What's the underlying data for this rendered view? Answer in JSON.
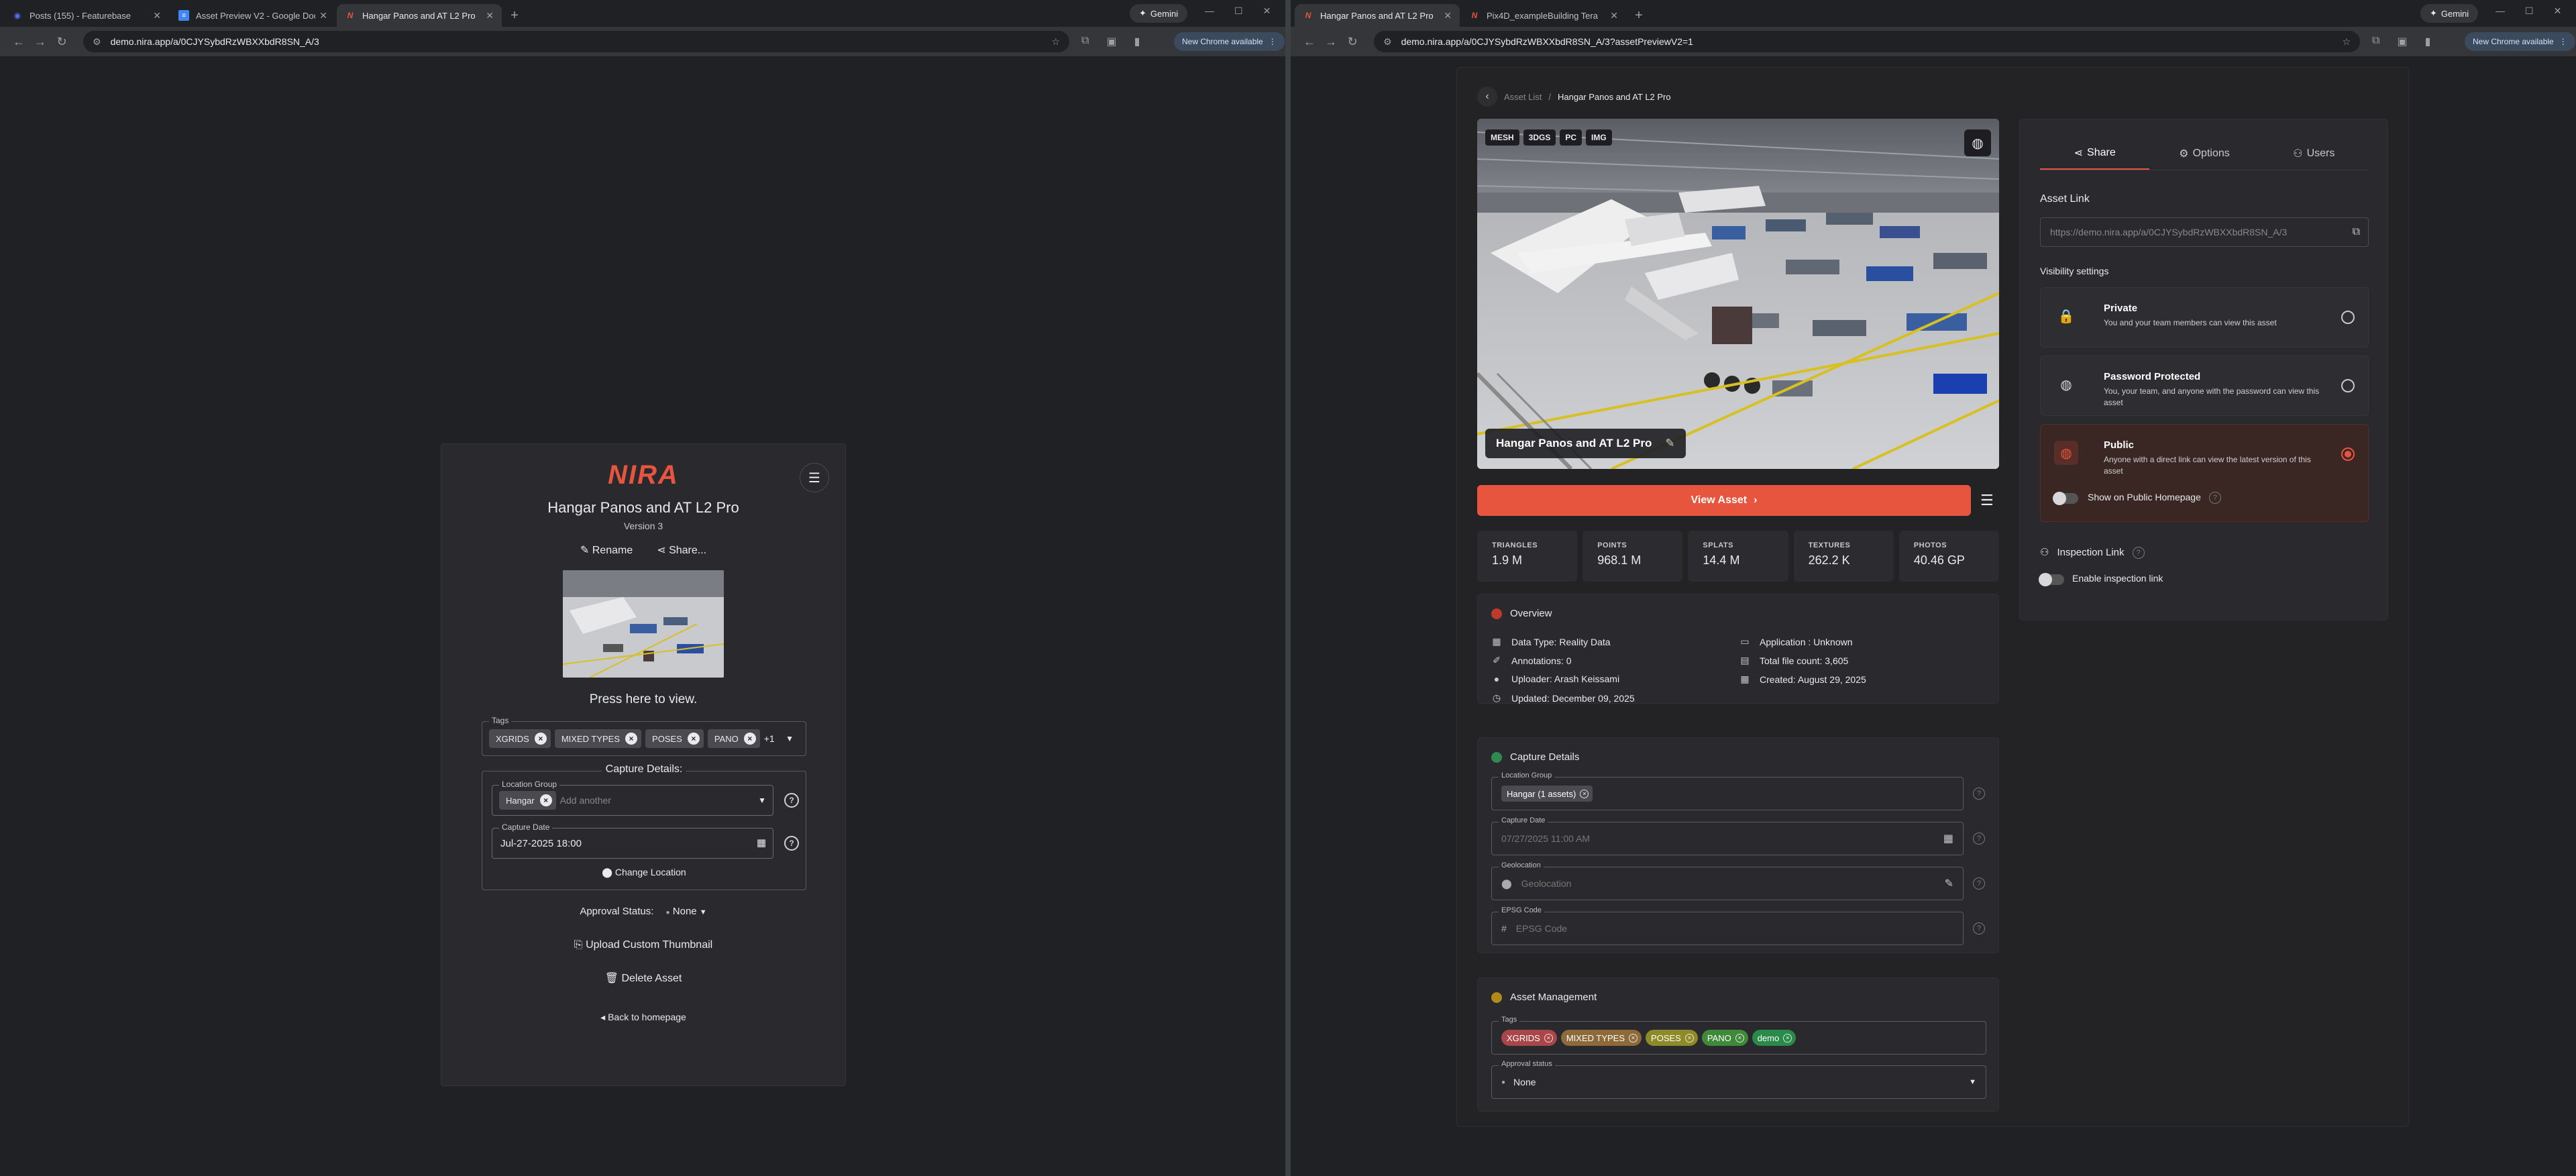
{
  "left_window": {
    "tabs": [
      {
        "title": "Posts (155) - Featurebase",
        "favicon": "F",
        "color": "#5b6cf5"
      },
      {
        "title": "Asset Preview V2 - Google Doc",
        "favicon": "D",
        "color": "#4285f4"
      },
      {
        "title": "Hangar Panos and AT L2 Pro",
        "favicon": "N",
        "color": "#e8553e"
      }
    ],
    "gemini": "Gemini",
    "url": "demo.nira.app/a/0CJYSybdRzWBXXbdR8SN_A/3",
    "update_label": "New Chrome available",
    "panel": {
      "logo": "NIRA",
      "title": "Hangar Panos and AT L2 Pro",
      "version": "Version 3",
      "rename": "Rename",
      "share": "Share...",
      "press_to_view": "Press here to view.",
      "tags_label": "Tags",
      "tags": [
        "XGRIDS",
        "MIXED TYPES",
        "POSES",
        "PANO"
      ],
      "tags_more": "+1",
      "capture_details": "Capture Details:",
      "location_group_label": "Location Group",
      "location_group_value": "Hangar",
      "location_placeholder": "Add another",
      "capture_date_label": "Capture Date",
      "capture_date_value": "Jul-27-2025 18:00",
      "change_location": "Change Location",
      "approval_label": "Approval Status:",
      "approval_value": "None",
      "upload_thumb": "Upload Custom Thumbnail",
      "delete": "Delete Asset",
      "back": "Back to homepage"
    }
  },
  "right_window": {
    "tabs": [
      {
        "title": "Hangar Panos and AT L2 Pro",
        "favicon": "N",
        "color": "#e8553e"
      },
      {
        "title": "Pix4D_exampleBuilding Tera",
        "favicon": "N",
        "color": "#e8553e"
      }
    ],
    "gemini": "Gemini",
    "url": "demo.nira.app/a/0CJYSybdRzWBXXbdR8SN_A/3?assetPreviewV2=1",
    "update_label": "New Chrome available",
    "breadcrumb": {
      "parent": "Asset List",
      "separator": "/",
      "current": "Hangar Panos and AT L2 Pro"
    },
    "viewer": {
      "badges": [
        "MESH",
        "3DGS",
        "PC",
        "IMG"
      ],
      "name": "Hangar Panos and AT L2 Pro"
    },
    "view_asset": "View Asset",
    "stats": [
      {
        "label": "TRIANGLES",
        "value": "1.9 M"
      },
      {
        "label": "POINTS",
        "value": "968.1 M"
      },
      {
        "label": "SPLATS",
        "value": "14.4 M"
      },
      {
        "label": "TEXTURES",
        "value": "262.2 K"
      },
      {
        "label": "PHOTOS",
        "value": "40.46 GP"
      }
    ],
    "overview": {
      "title": "Overview",
      "data_type": "Data Type: Reality Data",
      "annotations": "Annotations: 0",
      "uploader": "Uploader: Arash Keissami",
      "updated": "Updated: December 09, 2025",
      "application": "Application : Unknown",
      "file_count": "Total file count: 3,605",
      "created": "Created: August 29, 2025"
    },
    "capture": {
      "title": "Capture Details",
      "location_group_label": "Location Group",
      "location_group_chip": "Hangar (1 assets)",
      "capture_date_label": "Capture Date",
      "capture_date_value": "07/27/2025 11:00 AM",
      "geolocation_label": "Geolocation",
      "geolocation_placeholder": "Geolocation",
      "epsg_label": "EPSG Code",
      "epsg_placeholder": "EPSG Code"
    },
    "management": {
      "title": "Asset Management",
      "tags_label": "Tags",
      "tags": [
        {
          "label": "XGRIDS",
          "color": "#a8464a"
        },
        {
          "label": "MIXED TYPES",
          "color": "#8e6a3a"
        },
        {
          "label": "POSES",
          "color": "#8e8a2a"
        },
        {
          "label": "PANO",
          "color": "#3e8a3a"
        },
        {
          "label": "demo",
          "color": "#2a8a4a"
        }
      ],
      "approval_label": "Approval status",
      "approval_value": "None"
    },
    "share": {
      "tabs": [
        "Share",
        "Options",
        "Users"
      ],
      "asset_link_title": "Asset Link",
      "asset_link": "https://demo.nira.app/a/0CJYSybdRzWBXXbdR8SN_A/3",
      "visibility_title": "Visibility settings",
      "private_title": "Private",
      "private_desc": "You and your team members can view this asset",
      "password_title": "Password Protected",
      "password_desc": "You, your team, and anyone with the password can view this asset",
      "public_title": "Public",
      "public_desc": "Anyone with a direct link can view the latest version of this asset",
      "show_homepage": "Show on Public Homepage",
      "inspection_title": "Inspection Link",
      "enable_inspection": "Enable inspection link"
    }
  }
}
